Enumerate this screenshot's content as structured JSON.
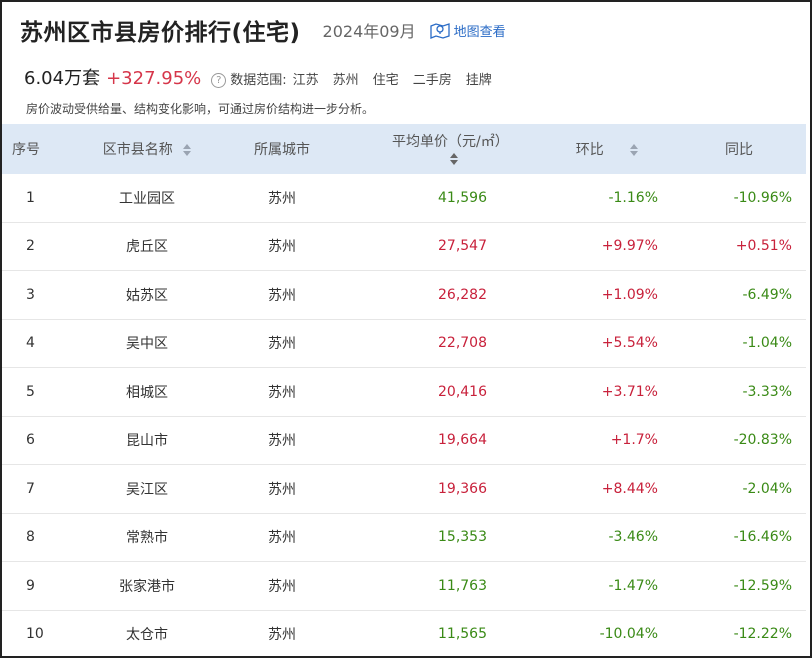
{
  "header": {
    "title": "苏州区市县房价排行(住宅)",
    "date": "2024年09月",
    "map_link": "地图查看"
  },
  "summary": {
    "price": "6.04万套",
    "change": "+327.95%",
    "scope_label": "数据范围:",
    "scope_items": [
      "江苏",
      "苏州",
      "住宅",
      "二手房",
      "挂牌"
    ],
    "note": "房价波动受供给量、结构变化影响，可通过房价结构进一步分析。"
  },
  "colors": {
    "up": "#c8213b",
    "down": "#3a8a16",
    "header_bg": "#dde8f5",
    "link": "#2a6bc6"
  },
  "table": {
    "columns": [
      "序号",
      "区市县名称",
      "所属城市",
      "平均单价（元/㎡）",
      "环比",
      "同比"
    ],
    "rows": [
      {
        "idx": "1",
        "name": "工业园区",
        "city": "苏州",
        "price": "41,596",
        "mom": "-1.16%",
        "yoy": "-10.96%"
      },
      {
        "idx": "2",
        "name": "虎丘区",
        "city": "苏州",
        "price": "27,547",
        "mom": "+9.97%",
        "yoy": "+0.51%"
      },
      {
        "idx": "3",
        "name": "姑苏区",
        "city": "苏州",
        "price": "26,282",
        "mom": "+1.09%",
        "yoy": "-6.49%"
      },
      {
        "idx": "4",
        "name": "吴中区",
        "city": "苏州",
        "price": "22,708",
        "mom": "+5.54%",
        "yoy": "-1.04%"
      },
      {
        "idx": "5",
        "name": "相城区",
        "city": "苏州",
        "price": "20,416",
        "mom": "+3.71%",
        "yoy": "-3.33%"
      },
      {
        "idx": "6",
        "name": "昆山市",
        "city": "苏州",
        "price": "19,664",
        "mom": "+1.7%",
        "yoy": "-20.83%"
      },
      {
        "idx": "7",
        "name": "吴江区",
        "city": "苏州",
        "price": "19,366",
        "mom": "+8.44%",
        "yoy": "-2.04%"
      },
      {
        "idx": "8",
        "name": "常熟市",
        "city": "苏州",
        "price": "15,353",
        "mom": "-3.46%",
        "yoy": "-16.46%"
      },
      {
        "idx": "9",
        "name": "张家港市",
        "city": "苏州",
        "price": "11,763",
        "mom": "-1.47%",
        "yoy": "-12.59%"
      },
      {
        "idx": "10",
        "name": "太仓市",
        "city": "苏州",
        "price": "11,565",
        "mom": "-10.04%",
        "yoy": "-12.22%"
      }
    ]
  }
}
